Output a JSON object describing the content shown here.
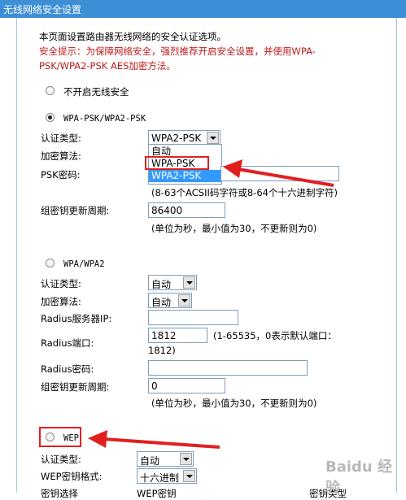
{
  "title": "无线网络安全设置",
  "intro": "本页面设置路由器无线网络的安全认证选项。",
  "tip_line1": "安全提示：为保障网络安全，强烈推荐开启安全设置，并使用WPA-",
  "tip_line2": "PSK/WPA2-PSK AES加密方法。",
  "no_security_label": "不开启无线安全",
  "wpa_psk": {
    "heading": "WPA-PSK/WPA2-PSK",
    "auth_label": "认证类型:",
    "auth_value": "WPA2-PSK",
    "auth_options": [
      "自动",
      "WPA-PSK",
      "WPA2-PSK"
    ],
    "cipher_label": "加密算法:",
    "psk_label": "PSK密码:",
    "psk_value": "",
    "psk_hint": "(8-63个ACSII码字符或8-64个十六进制字符)",
    "period_label": "组密钥更新周期:",
    "period_value": "86400",
    "period_hint": "(单位为秒，最小值为30，不更新则为0)"
  },
  "wpa": {
    "heading": "WPA/WPA2",
    "auth_label": "认证类型:",
    "auth_value": "自动",
    "cipher_label": "加密算法:",
    "cipher_value": "自动",
    "radius_ip_label": "Radius服务器IP:",
    "radius_ip_value": "",
    "radius_port_label": "Radius端口:",
    "radius_port_value": "1812",
    "radius_port_hint1": "(1-65535，0表示默认端口：",
    "radius_port_hint2": "1812)",
    "radius_pwd_label": "Radius密码:",
    "radius_pwd_value": "",
    "period_label": "组密钥更新周期:",
    "period_value": "0",
    "period_hint": "(单位为秒，最小值为30，不更新则为0)"
  },
  "wep": {
    "heading": "WEP",
    "auth_label": "认证类型:",
    "auth_value": "自动",
    "key_format_label": "WEP密钥格式:",
    "key_format_value": "十六进制",
    "col_key_select": "密钥选择",
    "col_wep_key": "WEP密钥",
    "col_key_type": "密钥类型"
  },
  "watermark": "Baidu 经验",
  "colors": {
    "titlebar": "#3d8fd6",
    "warning": "#c01818",
    "annotation": "#e02020",
    "highlight": "#3399ff"
  }
}
